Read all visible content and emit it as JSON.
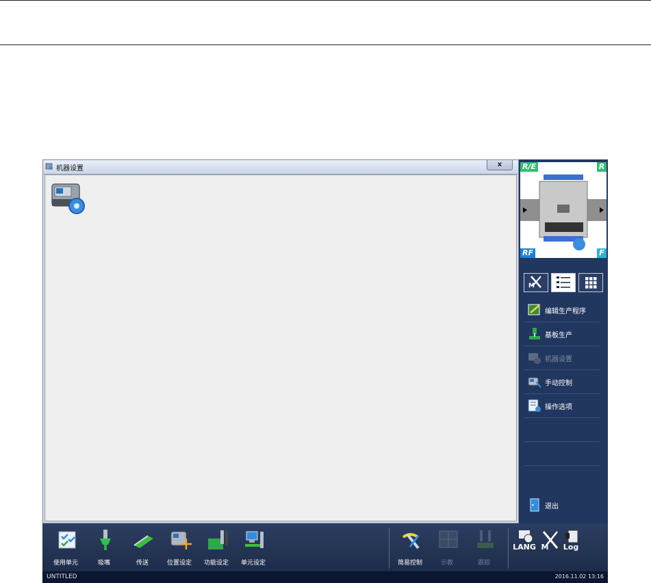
{
  "window": {
    "title": "机器设置",
    "close_label": "x"
  },
  "minimap": {
    "corner_tl": "R/E",
    "corner_tr": "R",
    "corner_bl": "RF",
    "corner_br": "F"
  },
  "tabs": [
    {
      "label": "M",
      "icon": "manual-tools-icon"
    },
    {
      "label": "",
      "icon": "list-icon"
    },
    {
      "label": "",
      "icon": "grid-icon"
    }
  ],
  "menu": {
    "items": [
      {
        "label": "编辑生产程序",
        "icon": "edit-program-icon",
        "enabled": true
      },
      {
        "label": "基板生产",
        "icon": "board-production-icon",
        "enabled": true
      },
      {
        "label": "机器设置",
        "icon": "machine-settings-icon",
        "enabled": false
      },
      {
        "label": "手动控制",
        "icon": "manual-control-icon",
        "enabled": true
      },
      {
        "label": "操作选项",
        "icon": "operation-options-icon",
        "enabled": true
      }
    ],
    "exit_label": "退出"
  },
  "toolbar": {
    "left_tools": [
      {
        "label": "使用单元",
        "icon": "use-unit-icon"
      },
      {
        "label": "吸嘴",
        "icon": "nozzle-icon"
      },
      {
        "label": "传送",
        "icon": "conveyor-icon"
      },
      {
        "label": "位置设定",
        "icon": "position-settings-icon"
      },
      {
        "label": "功能设定",
        "icon": "function-settings-icon"
      },
      {
        "label": "单元设定",
        "icon": "unit-settings-icon"
      }
    ],
    "mid_tools": [
      {
        "label": "简易控制",
        "icon": "simple-control-icon",
        "enabled": true
      },
      {
        "label": "示教",
        "icon": "teach-icon",
        "enabled": false
      },
      {
        "label": "跟踪",
        "icon": "trace-icon",
        "enabled": false
      }
    ],
    "right_tools": [
      {
        "label": "LANG",
        "icon": "language-icon"
      },
      {
        "label": "M",
        "icon": "maintenance-icon"
      },
      {
        "label": "Log",
        "icon": "log-icon"
      }
    ]
  },
  "status": {
    "file_name": "UNTITLED",
    "datetime": "2016.11.02 13:16"
  },
  "colors": {
    "panel_bg": "#22375f",
    "toolbar_bg": "#24365a",
    "corner_green": "#2fbf71",
    "corner_blue": "#1f7fd6",
    "corner_cyan": "#27b7d9"
  }
}
